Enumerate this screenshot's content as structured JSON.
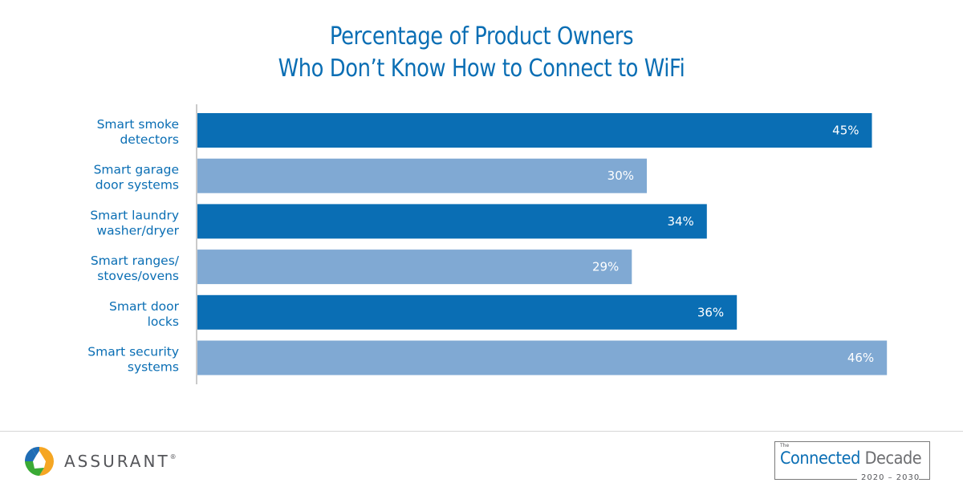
{
  "chart_data": {
    "type": "bar",
    "orientation": "horizontal",
    "title": "Percentage of Product Owners Who Don’t Know How to Connect to WiFi",
    "title_lines": [
      "Percentage of Product Owners",
      "Who Don’t Know How to Connect to WiFi"
    ],
    "categories": [
      [
        "Smart smoke",
        "detectors"
      ],
      [
        "Smart garage",
        "door systems"
      ],
      [
        "Smart laundry",
        "washer/dryer"
      ],
      [
        "Smart ranges/",
        "stoves/ovens"
      ],
      [
        "Smart door",
        "locks"
      ],
      [
        "Smart security",
        "systems"
      ]
    ],
    "values": [
      45,
      30,
      34,
      29,
      36,
      46
    ],
    "value_labels": [
      "45%",
      "30%",
      "34%",
      "29%",
      "36%",
      "46%"
    ],
    "bar_colors": [
      "#0a6eb4",
      "#80a9d3",
      "#0a6eb4",
      "#80a9d3",
      "#0a6eb4",
      "#80a9d3"
    ],
    "xlabel": "",
    "ylabel": "",
    "xlim": [
      0,
      50
    ],
    "grid": false,
    "legend": "none"
  },
  "footer": {
    "brand_name": "ASSURANT",
    "brand_mark": "®",
    "badge_the": "The",
    "badge_connected": "Connected",
    "badge_decade": "Decade",
    "badge_years": "2020 – 2030"
  }
}
